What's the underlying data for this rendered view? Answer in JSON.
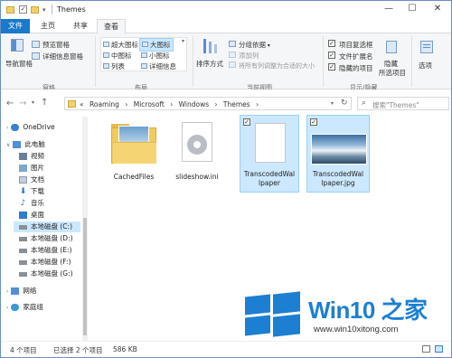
{
  "window": {
    "title": "Themes"
  },
  "title_controls": {
    "minimize": "—",
    "maximize": "☐",
    "close": "✕"
  },
  "tabs": [
    {
      "label": "文件"
    },
    {
      "label": "主页"
    },
    {
      "label": "共享"
    },
    {
      "label": "查看"
    }
  ],
  "ribbon": {
    "pane_group": {
      "nav_pane": "导航窗格",
      "preview_pane": "预览窗格",
      "details_pane": "详细信息窗格",
      "label": "窗格"
    },
    "layout_group": {
      "extra_large": "超大图标",
      "large": "大图标",
      "medium": "中图标",
      "small": "小图标",
      "list": "列表",
      "details": "详细信息",
      "label": "布局"
    },
    "view_group": {
      "sort": "排序方式",
      "group_by": "分组依据",
      "add_columns": "添加列",
      "fit_columns": "将所有列调整为合适的大小",
      "label": "当前视图"
    },
    "show_group": {
      "item_checkboxes": "项目复选框",
      "file_extensions": "文件扩展名",
      "hidden_items": "隐藏的项目",
      "hide": "隐藏",
      "hide_selected": "所选项目",
      "label": "显示/隐藏"
    },
    "options_label": "选项"
  },
  "address": {
    "parts": [
      "Roaming",
      "Microsoft",
      "Windows",
      "Themes"
    ],
    "prefix": "«",
    "separator": "›",
    "search_placeholder": "搜索\"Themes\""
  },
  "nav": {
    "items": [
      {
        "label": "OneDrive"
      },
      {
        "label": "此电脑"
      },
      {
        "label": "视频"
      },
      {
        "label": "图片"
      },
      {
        "label": "文档"
      },
      {
        "label": "下载"
      },
      {
        "label": "音乐"
      },
      {
        "label": "桌面"
      },
      {
        "label": "本地磁盘 (C:)"
      },
      {
        "label": "本地磁盘 (D:)"
      },
      {
        "label": "本地磁盘 (E:)"
      },
      {
        "label": "本地磁盘 (F:)"
      },
      {
        "label": "本地磁盘 (G:)"
      },
      {
        "label": "网络"
      },
      {
        "label": "家庭组"
      }
    ]
  },
  "files": [
    {
      "name": "CachedFiles",
      "type": "folder"
    },
    {
      "name": "slideshow.ini",
      "type": "settings"
    },
    {
      "name": "TranscodedWallpaper",
      "name_lines": [
        "TranscodedWal",
        "lpaper"
      ],
      "type": "blank",
      "selected": true
    },
    {
      "name": "TranscodedWallpaper.jpg",
      "name_lines": [
        "TranscodedWal",
        "lpaper.jpg"
      ],
      "type": "image",
      "selected": true
    }
  ],
  "status": {
    "count": "4 个项目",
    "selected": "已选择 2 个项目",
    "size": "586 KB"
  },
  "watermark": {
    "brand": "Win10 之家",
    "url": "www.win10xitong.com"
  },
  "colors": {
    "accent": "#1979ca",
    "selection": "#cce8ff",
    "brand": "#1c7fd1"
  }
}
